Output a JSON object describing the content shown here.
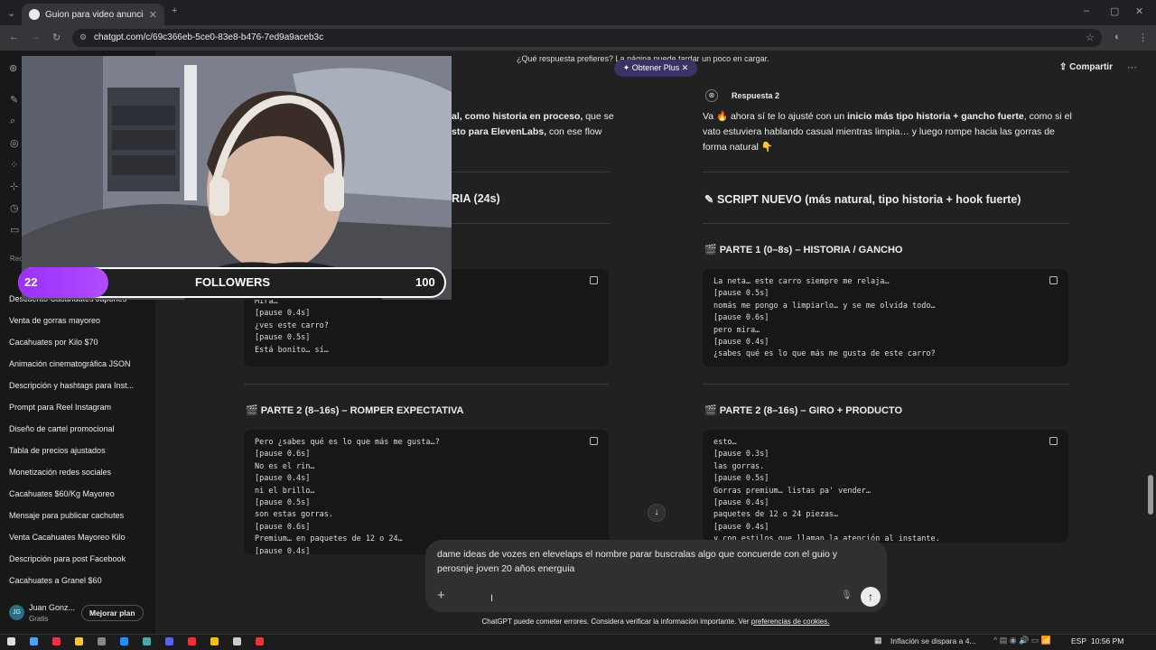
{
  "browser": {
    "tab_title": "Guion para video anuncio",
    "url": "chatgpt.com/c/69c366eb-5ce0-83e8-b476-7ed9a9aceb3c"
  },
  "header": {
    "banner": "¿Qué respuesta prefieres? La página puede tardar un poco en cargar.",
    "plus_label": "Obtener Plus",
    "share_label": "Compartir"
  },
  "sidebar": {
    "section": "Rec",
    "items": [
      "Descuento Cacahuates Japonés",
      "Venta de gorras mayoreo",
      "Cacahuates por Kilo $70",
      "Animación cinematográfica JSON",
      "Descripción y hashtags para Inst...",
      "Prompt para Reel Instagram",
      "Diseño de cartel promocional",
      "Tabla de precios ajustados",
      "Monetización redes sociales",
      "Cacahuates $60/Kg Mayoreo",
      "Mensaje para publicar cachutes",
      "Venta Cacahuates Mayoreo Kilo",
      "Descripción para post Facebook",
      "Cacahuates a Granel $60"
    ],
    "user": {
      "initials": "JG",
      "name": "Juan Gonz...",
      "plan": "Gratis",
      "upgrade": "Mejorar plan"
    }
  },
  "left": {
    "intro1_pre": "al, como historia en proceso,",
    "intro1_post": " que se",
    "intro2_pre": "sto para ElevenLabs,",
    "intro2_post": " con ese flow",
    "heading1": "RIA (24s)",
    "code1": [
      "Mira…",
      "[pause 0.4s]",
      "¿ves este carro?",
      "[pause 0.5s]",
      "Está bonito… sí…"
    ],
    "heading2": "PARTE 2 (8–16s) – ROMPER EXPECTATIVA",
    "code2": [
      "Pero ¿sabes qué es lo que más me gusta…?",
      "[pause 0.6s]",
      "No es el rin…",
      "[pause 0.4s]",
      "ni el brillo…",
      "[pause 0.5s]",
      "son estas gorras.",
      "[pause 0.6s]",
      "Premium… en paquetes de 12 o 24…",
      "[pause 0.4s]"
    ]
  },
  "right": {
    "label": "Respuesta 2",
    "intro_a": "Va 🔥 ahora sí te lo ajusté con un ",
    "intro_b": "inicio más tipo historia + gancho fuerte",
    "intro_c": ", como si el",
    "intro_line2": "vato estuviera hablando casual mientras limpia… y luego rompe hacia las gorras de",
    "intro_line3": "forma natural 👇",
    "heading": "SCRIPT NUEVO (más natural, tipo historia + hook fuerte)",
    "part1": "PARTE 1 (0–8s) – HISTORIA / GANCHO",
    "code1": [
      "La neta… este carro siempre me relaja…",
      "[pause 0.5s]",
      "nomás me pongo a limpiarlo… y se me olvida todo…",
      "[pause 0.6s]",
      "pero mira…",
      "[pause 0.4s]",
      "¿sabes qué es lo que más me gusta de este carro?"
    ],
    "part2": "PARTE 2 (8–16s) – GIRO + PRODUCTO",
    "code2": [
      "esto…",
      "[pause 0.3s]",
      "las gorras.",
      "[pause 0.5s]",
      "Gorras premium… listas pa' vender…",
      "[pause 0.4s]",
      "paquetes de 12 o 24 piezas…",
      "[pause 0.4s]",
      "y con estilos que llaman la atención al instante."
    ]
  },
  "composer": {
    "text": "dame ideas de vozes en elevelaps el nombre parar buscralas algo que concuerde con el guio y perosnje joven 20 años energuia"
  },
  "footer": {
    "text": "ChatGPT puede cometer errores. Considera verificar la información importante. Ver ",
    "link": "preferencias de cookies."
  },
  "overlay": {
    "count_left": "22",
    "label": "FOLLOWERS",
    "count_right": "100"
  },
  "taskbar": {
    "news": "Inflación se dispara a 4...",
    "lang": "ESP",
    "time": "10:56 PM"
  },
  "colors": {
    "accent_purple": "#9b30ff",
    "plus_bg": "#3b3363"
  }
}
